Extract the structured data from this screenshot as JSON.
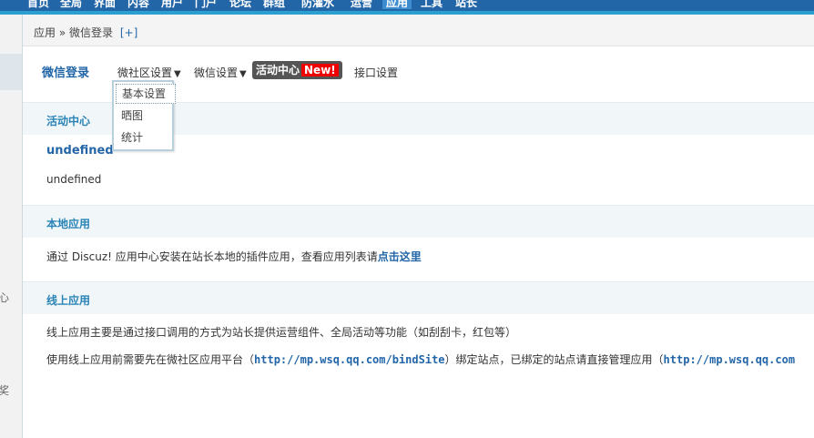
{
  "top_nav": {
    "items": [
      "首页",
      "全局",
      "界面",
      "内容",
      "用户",
      "门户",
      "论坛",
      "群组",
      "防灌水",
      "运营",
      "应用",
      "工具",
      "站长"
    ],
    "active_index": 10
  },
  "left_nav": {
    "cut_labels": [
      "心",
      "奖"
    ]
  },
  "breadcrumb": {
    "section": "应用",
    "separator": "»",
    "page": "微信登录",
    "add": "[+]"
  },
  "tabs": {
    "title": "微信登录",
    "community_settings": "微社区设置",
    "wechat_settings": "微信设置",
    "activity_center": "活动中心",
    "new_badge": "New!",
    "api_settings": "接口设置",
    "caret": "▼"
  },
  "dropdown": {
    "items": [
      "基本设置",
      "晒图",
      "统计"
    ]
  },
  "sections": {
    "activity_center": "活动中心",
    "local_apps": "本地应用",
    "online_apps": "线上应用"
  },
  "activity": {
    "title": "undefined",
    "text": "undefined"
  },
  "local": {
    "text": "通过 Discuz! 应用中心安装在站长本地的插件应用，查看应用列表请",
    "link": "点击这里"
  },
  "online": {
    "line1": "线上应用主要是通过接口调用的方式为站长提供运营组件、全局活动等功能（如刮刮卡，红包等）",
    "line2_prefix": "使用线上应用前需要先在微社区应用平台（",
    "link1": "http://mp.wsq.qq.com/bindSite",
    "line2_mid": "）绑定站点，已绑定的站点请直接管理应用（",
    "link2": "http://mp.wsq.qq.com"
  },
  "colors": {
    "topbar": "#2366a8",
    "stripe": "#2a9fd0",
    "section_bg": "#f1f6f9",
    "section_title": "#2a84b6",
    "badge_red": "#ee0000",
    "link": "#2366a8"
  }
}
